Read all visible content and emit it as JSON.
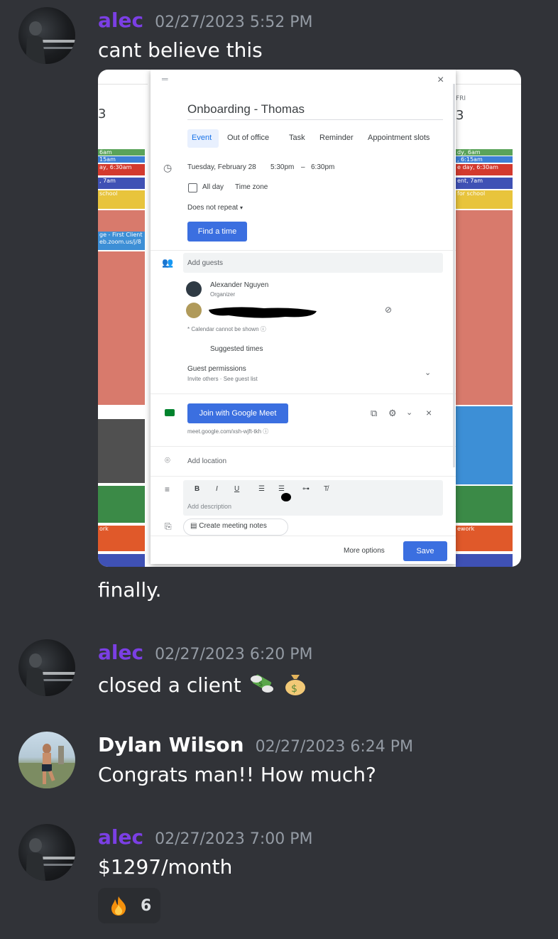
{
  "messages": [
    {
      "user": "alec",
      "timestamp": "02/27/2023 5:52 PM",
      "lines": [
        "cant believe this",
        "finally."
      ]
    },
    {
      "user": "alec",
      "timestamp": "02/27/2023 6:20 PM",
      "text": "closed a client"
    },
    {
      "user": "Dylan Wilson",
      "timestamp": "02/27/2023 6:24 PM",
      "text": "Congrats man!! How much?"
    },
    {
      "user": "alec",
      "timestamp": "02/27/2023 7:00 PM",
      "text": "$1297/month",
      "reaction": {
        "emoji": "fire-emoji",
        "count": "6"
      }
    }
  ],
  "attachment": {
    "left_day": {
      "events": [
        "6am",
        "15am",
        "ay, 6:30am",
        ", 7am",
        "school",
        "ge - First Client",
        "eb.zoom.us/j/8",
        "ork"
      ]
    },
    "right_day": {
      "header_day": "FRI",
      "header_num": "3",
      "events": [
        "dy, 6am",
        ", 6:15am",
        "e day, 6:30am",
        "ent, 7am",
        "for school",
        "ework"
      ]
    },
    "dialog": {
      "title": "Onboarding - Thomas",
      "tabs": [
        "Event",
        "Out of office",
        "Task",
        "Reminder",
        "Appointment slots"
      ],
      "date": "Tuesday, February 28",
      "start": "5:30pm",
      "dash": "–",
      "end": "6:30pm",
      "all_day": "All day",
      "time_zone": "Time zone",
      "repeat": "Does not repeat",
      "find_time": "Find a time",
      "add_guests": "Add guests",
      "organizer_name": "Alexander Nguyen",
      "organizer_role": "Organizer",
      "calendar_note": "* Calendar cannot be shown",
      "suggested_times": "Suggested times",
      "guest_permissions": "Guest permissions",
      "guest_permissions_sub": "Invite others · See guest list",
      "meet_button": "Join with Google Meet",
      "meet_link": "meet.google.com/xsh-wjft-tkh",
      "add_location": "Add location",
      "add_description": "Add description",
      "meeting_notes": "Create meeting notes",
      "more_options": "More options",
      "save": "Save"
    }
  },
  "colors": {
    "background": "#313338",
    "alec_name": "#7b3fe4",
    "timestamp": "#949ba4",
    "google_blue": "#3b6fe0"
  }
}
